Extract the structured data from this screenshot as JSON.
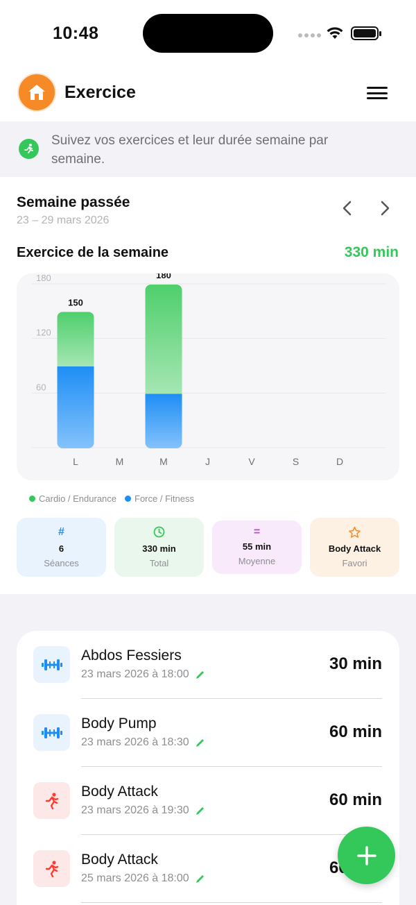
{
  "status": {
    "time": "10:48"
  },
  "nav": {
    "title": "Exercice"
  },
  "banner": {
    "text": "Suivez vos exercices et leur durée semaine par semaine."
  },
  "week": {
    "title": "Semaine passée",
    "dates": "23 – 29 mars 2026"
  },
  "section": {
    "title": "Exercice de la semaine",
    "total": "330 min"
  },
  "colors": {
    "cardio": "#34c759",
    "force": "#1e8ef5",
    "accent": "#34c759",
    "home": "#f58a27",
    "attack": "#ff3b30"
  },
  "chart_data": {
    "type": "bar",
    "stacked": true,
    "categories": [
      "L",
      "M",
      "M",
      "J",
      "V",
      "S",
      "D"
    ],
    "series": [
      {
        "name": "Force / Fitness",
        "values": [
          90,
          0,
          60,
          0,
          0,
          0,
          0
        ]
      },
      {
        "name": "Cardio / Endurance",
        "values": [
          60,
          0,
          120,
          0,
          0,
          0,
          0
        ]
      }
    ],
    "totals": [
      150,
      0,
      180,
      0,
      0,
      0,
      0
    ],
    "total_labels": [
      "150",
      "",
      "180",
      "",
      "",
      "",
      ""
    ],
    "yticks": [
      60,
      120,
      180
    ],
    "ytick_labels": [
      "60",
      "120",
      "180"
    ],
    "ylim": [
      0,
      180
    ],
    "grid": true,
    "legend": "bottom-left"
  },
  "legend": {
    "cardio": "Cardio / Endurance",
    "force": "Force / Fitness"
  },
  "stats": [
    {
      "icon": "#",
      "value": "6",
      "label": "Séances",
      "bg": "#e8f3fe",
      "fg": "#1e8ef5"
    },
    {
      "icon": "clock",
      "value": "330 min",
      "label": "Total",
      "bg": "#eaf7ec",
      "fg": "#34c759"
    },
    {
      "icon": "=",
      "value": "55 min",
      "label": "Moyenne",
      "bg": "#f8e9fb",
      "fg": "#c544d6"
    },
    {
      "icon": "star",
      "value": "Body Attack",
      "label": "Favori",
      "bg": "#fdf1e4",
      "fg": "#f58a27"
    }
  ],
  "sessions": [
    {
      "title": "Abdos Fessiers",
      "date": "23 mars 2026 à 18:00",
      "duration": "30 min",
      "kind": "force"
    },
    {
      "title": "Body Pump",
      "date": "23 mars 2026 à 18:30",
      "duration": "60 min",
      "kind": "force"
    },
    {
      "title": "Body Attack",
      "date": "23 mars 2026 à 19:30",
      "duration": "60 min",
      "kind": "cardio"
    },
    {
      "title": "Body Attack",
      "date": "25 mars 2026 à 18:00",
      "duration": "60 min",
      "kind": "cardio"
    }
  ]
}
